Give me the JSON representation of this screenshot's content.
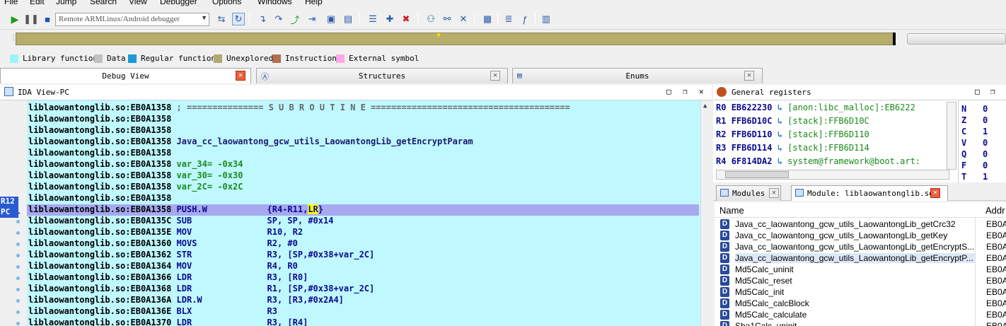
{
  "menu": [
    "File",
    "Edit",
    "Jump",
    "Search",
    "View",
    "Debugger",
    "Options",
    "Windows",
    "Help"
  ],
  "toolbar": {
    "debugger_select": "Remote ARMLinux/Android debugger"
  },
  "legend": [
    {
      "label": "Library function",
      "color": "#9cf4f8"
    },
    {
      "label": "Data",
      "color": "#c0c0c0"
    },
    {
      "label": "Regular function",
      "color": "#1c9ad8"
    },
    {
      "label": "Unexplored",
      "color": "#b0a870"
    },
    {
      "label": "Instruction",
      "color": "#b07050"
    },
    {
      "label": "External symbol",
      "color": "#ffa8e8"
    }
  ],
  "tabs": [
    "Debug View",
    "Structures",
    "Enums"
  ],
  "ida_view": {
    "title": "IDA View-PC",
    "reg_tags": [
      "R12",
      "PC"
    ],
    "lines": [
      {
        "addr": "liblaowantonglib.so:EB0A1358",
        "rest": " ; =============== S U B R O U T I N E =======================================",
        "kind": "sub"
      },
      {
        "addr": "liblaowantonglib.so:EB0A1358",
        "rest": "",
        "kind": "plain"
      },
      {
        "addr": "liblaowantonglib.so:EB0A1358",
        "rest": "",
        "kind": "plain"
      },
      {
        "addr": "liblaowantonglib.so:EB0A1358",
        "rest": " Java_cc_laowantong_gcw_utils_LaowantongLib_getEncryptParam",
        "kind": "name"
      },
      {
        "addr": "liblaowantonglib.so:EB0A1358",
        "rest": "",
        "kind": "plain"
      },
      {
        "addr": "liblaowantonglib.so:EB0A1358",
        "rest": " var_34= -0x34",
        "kind": "var"
      },
      {
        "addr": "liblaowantonglib.so:EB0A1358",
        "rest": " var_30= -0x30",
        "kind": "var"
      },
      {
        "addr": "liblaowantonglib.so:EB0A1358",
        "rest": " var_2C= -0x2C",
        "kind": "var"
      },
      {
        "addr": "liblaowantonglib.so:EB0A1358",
        "rest": "",
        "kind": "plain"
      },
      {
        "addr": "liblaowantonglib.so:EB0A1358",
        "mnem": "PUSH.W",
        "ops_pre": "{R4-R11,",
        "ops_hl": "LR",
        "ops_post": "}",
        "kind": "hl"
      },
      {
        "addr": "liblaowantonglib.so:EB0A135C",
        "mnem": "SUB",
        "ops": "SP, SP, #0x14",
        "kind": "ins"
      },
      {
        "addr": "liblaowantonglib.so:EB0A135E",
        "mnem": "MOV",
        "ops": "R10, R2",
        "kind": "ins"
      },
      {
        "addr": "liblaowantonglib.so:EB0A1360",
        "mnem": "MOVS",
        "ops": "R2, #0",
        "kind": "ins"
      },
      {
        "addr": "liblaowantonglib.so:EB0A1362",
        "mnem": "STR",
        "ops": "R3, [SP,#0x38+var_2C]",
        "kind": "ins"
      },
      {
        "addr": "liblaowantonglib.so:EB0A1364",
        "mnem": "MOV",
        "ops": "R4, R0",
        "kind": "ins"
      },
      {
        "addr": "liblaowantonglib.so:EB0A1366",
        "mnem": "LDR",
        "ops": "R3, [R0]",
        "kind": "ins"
      },
      {
        "addr": "liblaowantonglib.so:EB0A1368",
        "mnem": "LDR",
        "ops": "R1, [SP,#0x38+var_2C]",
        "kind": "ins"
      },
      {
        "addr": "liblaowantonglib.so:EB0A136A",
        "mnem": "LDR.W",
        "ops": "R3, [R3,#0x2A4]",
        "kind": "ins"
      },
      {
        "addr": "liblaowantonglib.so:EB0A136E",
        "mnem": "BLX",
        "ops": "R3",
        "kind": "ins"
      },
      {
        "addr": "liblaowantonglib.so:EB0A1370",
        "mnem": "LDR",
        "ops": "R3, [R4]",
        "kind": "ins"
      }
    ]
  },
  "registers": {
    "title": "General registers",
    "rows": [
      {
        "name": "R0",
        "value": "EB622230",
        "desc": "[anon:libc_malloc]:EB6222"
      },
      {
        "name": "R1",
        "value": "FFB6D10C",
        "desc": "[stack]:FFB6D10C"
      },
      {
        "name": "R2",
        "value": "FFB6D110",
        "desc": "[stack]:FFB6D110"
      },
      {
        "name": "R3",
        "value": "FFB6D114",
        "desc": "[stack]:FFB6D114"
      },
      {
        "name": "R4",
        "value": "6F814DA2",
        "desc": "system@framework@boot.art:"
      }
    ],
    "flags": [
      {
        "name": "N",
        "value": "0"
      },
      {
        "name": "Z",
        "value": "0"
      },
      {
        "name": "C",
        "value": "1"
      },
      {
        "name": "V",
        "value": "0"
      },
      {
        "name": "Q",
        "value": "0"
      },
      {
        "name": "F",
        "value": "0"
      },
      {
        "name": "T",
        "value": "1"
      }
    ]
  },
  "modules": {
    "tabs": [
      "Modules",
      "Module: liblaowantonglib.so"
    ],
    "col_name": "Name",
    "col_addr": "Addr",
    "rows": [
      {
        "name": "Java_cc_laowantong_gcw_utils_LaowantongLib_getCrc32",
        "addr": "EB0A",
        "icon": "D",
        "selected": false
      },
      {
        "name": "Java_cc_laowantong_gcw_utils_LaowantongLib_getKey",
        "addr": "EB0A",
        "icon": "D",
        "selected": false
      },
      {
        "name": "Java_cc_laowantong_gcw_utils_LaowantongLib_getEncryptS...",
        "addr": "EB0A",
        "icon": "D",
        "selected": false
      },
      {
        "name": "Java_cc_laowantong_gcw_utils_LaowantongLib_getEncryptP...",
        "addr": "EB0A",
        "icon": "D",
        "selected": true
      },
      {
        "name": "Md5Calc_uninit",
        "addr": "EB0A",
        "icon": "D",
        "selected": false
      },
      {
        "name": "Md5Calc_reset",
        "addr": "EB0A",
        "icon": "D",
        "selected": false
      },
      {
        "name": "Md5Calc_init",
        "addr": "EB0A",
        "icon": "D",
        "selected": false
      },
      {
        "name": "Md5Calc_calcBlock",
        "addr": "EB0A",
        "icon": "D",
        "selected": false
      },
      {
        "name": "Md5Calc_calculate",
        "addr": "EB0A",
        "icon": "D",
        "selected": false
      },
      {
        "name": "Sha1Calc_uninit",
        "addr": "EB0A",
        "icon": "D",
        "selected": false
      }
    ]
  }
}
